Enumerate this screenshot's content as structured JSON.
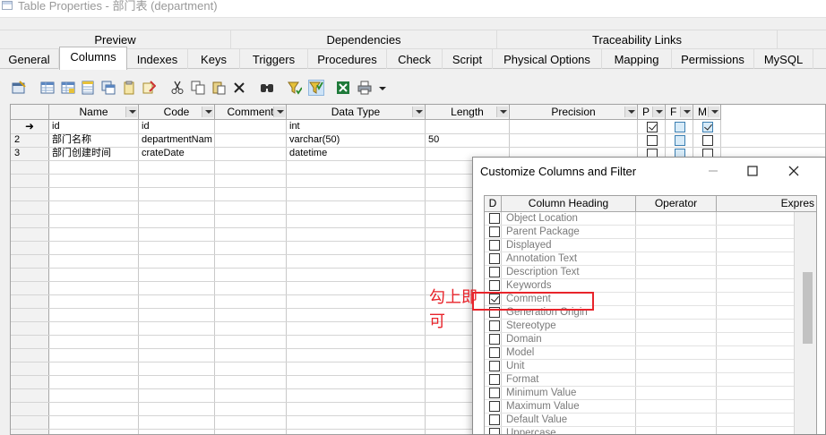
{
  "window": {
    "title": "Table Properties - 部门表 (department)"
  },
  "tabs_top": [
    {
      "label": "Preview"
    },
    {
      "label": "Dependencies"
    },
    {
      "label": "Traceability Links"
    }
  ],
  "tabs": [
    {
      "label": "General"
    },
    {
      "label": "Columns",
      "active": true
    },
    {
      "label": "Indexes"
    },
    {
      "label": "Keys"
    },
    {
      "label": "Triggers"
    },
    {
      "label": "Procedures"
    },
    {
      "label": "Check"
    },
    {
      "label": "Script"
    },
    {
      "label": "Physical Options"
    },
    {
      "label": "Mapping"
    },
    {
      "label": "Permissions"
    },
    {
      "label": "MySQL"
    }
  ],
  "grid": {
    "headers": [
      "Name",
      "Code",
      "Comment",
      "Data Type",
      "Length",
      "Precision",
      "P",
      "F",
      "M"
    ],
    "current_row_marker": "➜",
    "rows": [
      {
        "num": "",
        "name": "id",
        "code": "id",
        "comment": "",
        "type": "int",
        "length": "",
        "precision": "",
        "p": true,
        "f": false,
        "m": true
      },
      {
        "num": "2",
        "name": "部门名称",
        "code": "departmentNam",
        "comment": "",
        "type": "varchar(50)",
        "length": "50",
        "precision": "",
        "p": false,
        "f": false,
        "m": false
      },
      {
        "num": "3",
        "name": "部门创建时间",
        "code": "crateDate",
        "comment": "",
        "type": "datetime",
        "length": "",
        "precision": "",
        "p": false,
        "f": false,
        "m": false
      }
    ]
  },
  "dialog": {
    "title": "Customize Columns and Filter",
    "headers": [
      "D",
      "Column Heading",
      "Operator",
      "Expres"
    ],
    "items": [
      {
        "label": "Object Location",
        "checked": false
      },
      {
        "label": "Parent Package",
        "checked": false
      },
      {
        "label": "Displayed",
        "checked": false
      },
      {
        "label": "Annotation Text",
        "checked": false
      },
      {
        "label": "Description Text",
        "checked": false
      },
      {
        "label": "Keywords",
        "checked": false
      },
      {
        "label": "Comment",
        "checked": true
      },
      {
        "label": "Generation Origin",
        "checked": false
      },
      {
        "label": "Stereotype",
        "checked": false
      },
      {
        "label": "Domain",
        "checked": false
      },
      {
        "label": "Model",
        "checked": false
      },
      {
        "label": "Unit",
        "checked": false
      },
      {
        "label": "Format",
        "checked": false
      },
      {
        "label": "Minimum Value",
        "checked": false
      },
      {
        "label": "Maximum Value",
        "checked": false
      },
      {
        "label": "Default Value",
        "checked": false
      },
      {
        "label": "Uppercase",
        "checked": false
      }
    ]
  },
  "annotation": {
    "text": "勾上即可",
    "color": "#e8242b"
  },
  "colors": {
    "accent": "#3c7fb1",
    "annotation": "#e8242b"
  },
  "toolbar_icons": [
    "properties-icon",
    "insert-row-icon",
    "add-row-icon",
    "add-columns-icon",
    "replicate-icon",
    "paste-icon",
    "rename-icon",
    "cut-icon",
    "copy-icon",
    "paste-clipboard-icon",
    "delete-icon",
    "find-icon",
    "filter-icon",
    "customize-columns-icon",
    "excel-export-icon",
    "print-icon",
    "dropdown-arrow-icon"
  ]
}
